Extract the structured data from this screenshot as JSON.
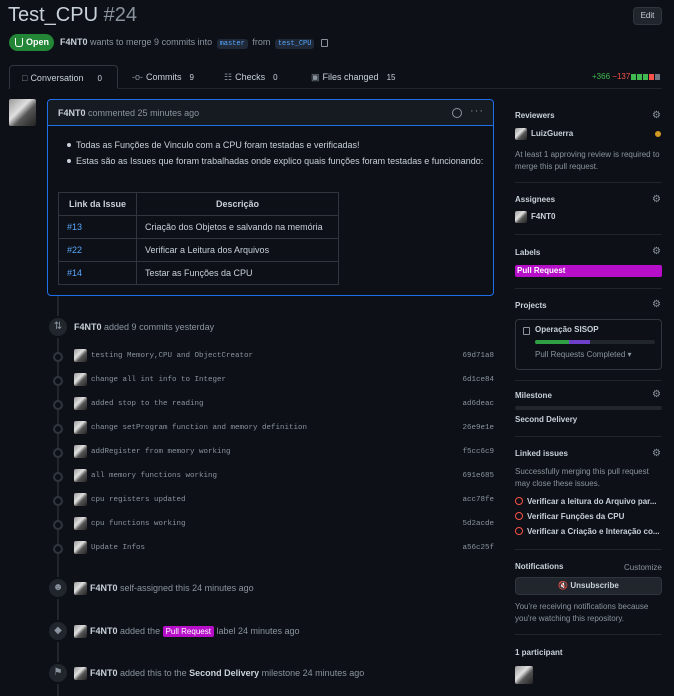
{
  "pr": {
    "title": "Test_CPU",
    "number": "#24",
    "edit_label": "Edit",
    "status": "Open",
    "author": "F4NT0",
    "merge_text": "wants to merge 9 commits into",
    "base_branch": "master",
    "from_text": "from",
    "head_branch": "test_CPU"
  },
  "tabs": [
    {
      "label": "Conversation",
      "count": "0"
    },
    {
      "label": "Commits",
      "count": "9"
    },
    {
      "label": "Checks",
      "count": "0"
    },
    {
      "label": "Files changed",
      "count": "15"
    }
  ],
  "diffstat": {
    "additions": "+366",
    "deletions": "−137"
  },
  "comment": {
    "author": "F4NT0",
    "meta": "commented 25 minutes ago",
    "bullets": [
      "Todas as Funções de Vinculo com a CPU foram testadas e verificadas!",
      "Estas são as Issues que foram trabalhadas onde explico quais funções foram testadas e funcionando:"
    ],
    "table_headers": [
      "Link da Issue",
      "Descrição"
    ],
    "table_rows": [
      [
        "#13",
        "Criação dos Objetos e salvando na memória"
      ],
      [
        "#22",
        "Verificar a Leitura dos Arquivos"
      ],
      [
        "#14",
        "Testar as Funções da CPU"
      ]
    ]
  },
  "commits_event": {
    "author": "F4NT0",
    "text": "added 9 commits yesterday"
  },
  "commits": [
    {
      "msg": "testing Memory,CPU and ObjectCreator",
      "sha": "69d71a8"
    },
    {
      "msg": "change all int info to Integer",
      "sha": "6d1ce84"
    },
    {
      "msg": "added stop to the reading",
      "sha": "ad6deac"
    },
    {
      "msg": "change setProgram function and memory definition",
      "sha": "26e9e1e"
    },
    {
      "msg": "addRegister from memory working",
      "sha": "f5cc6c9"
    },
    {
      "msg": "all memory functions working",
      "sha": "691e685"
    },
    {
      "msg": "cpu registers updated",
      "sha": "acc78fe"
    },
    {
      "msg": "cpu functions working",
      "sha": "5d2acde"
    },
    {
      "msg": "Update Infos",
      "sha": "a56c25f"
    }
  ],
  "events": {
    "assigned": {
      "author": "F4NT0",
      "text": "self-assigned this 24 minutes ago"
    },
    "labeled": {
      "author": "F4NT0",
      "pre": "added the",
      "label": "Pull Request",
      "post": "label 24 minutes ago"
    },
    "milestone": {
      "author": "F4NT0",
      "pre": "added this to the",
      "milestone": "Second Delivery",
      "post": "milestone 24 minutes ago"
    }
  },
  "sidebar": {
    "reviewers": {
      "heading": "Reviewers",
      "name": "LuizGuerra",
      "note": "At least 1 approving review is required to merge this pull request."
    },
    "assignees": {
      "heading": "Assignees",
      "name": "F4NT0"
    },
    "labels": {
      "heading": "Labels",
      "label": "Pull Request",
      "label_color": "#b60ec9"
    },
    "projects": {
      "heading": "Projects",
      "name": "Operação SISOP",
      "column": "Pull Requests Completed"
    },
    "milestone": {
      "heading": "Milestone",
      "name": "Second Delivery"
    },
    "linked": {
      "heading": "Linked issues",
      "note": "Successfully merging this pull request may close these issues.",
      "issues": [
        "Verificar a leitura do Arquivo par...",
        "Verificar Funções da CPU",
        "Verificar a Criação e Interação co..."
      ]
    },
    "notifications": {
      "heading": "Notifications",
      "customize": "Customize",
      "button": "Unsubscribe",
      "note": "You're receiving notifications because you're watching this repository."
    },
    "participants": {
      "heading": "1 participant"
    }
  },
  "colors": {
    "open_green": "#238636",
    "link_blue": "#58a6ff",
    "label_purple": "#b60ec9",
    "issue_red": "#f85149"
  }
}
